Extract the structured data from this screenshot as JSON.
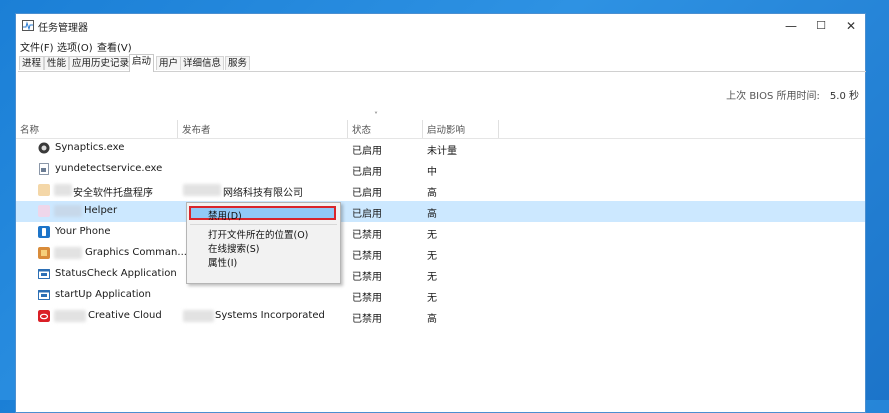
{
  "window": {
    "title": "任务管理器",
    "controls": [
      "—",
      "☐",
      "✕"
    ]
  },
  "menu": [
    "文件(F)",
    "选项(O)",
    "查看(V)"
  ],
  "tabs": [
    "进程",
    "性能",
    "应用历史记录",
    "启动",
    "用户",
    "详细信息",
    "服务"
  ],
  "active_tab": "启动",
  "bios": {
    "label": "上次 BIOS 所用时间:",
    "value": "5.0 秒"
  },
  "columns": {
    "name": "名称",
    "publisher": "发布者",
    "status": "状态",
    "impact": "启动影响"
  },
  "sort_indicator": "˅",
  "rows": [
    {
      "name": "Synaptics.exe",
      "publisher": "",
      "status": "已启用",
      "impact": "未计量",
      "icon_color": "#3a3a3a",
      "icon": "synaptics-icon"
    },
    {
      "name": "yundetectservice.exe",
      "publisher": "",
      "status": "已启用",
      "impact": "中",
      "icon_color": "#6b7c93",
      "icon": "exe-icon"
    },
    {
      "name": "安全软件托盘程序",
      "publisher": "网络科技有限公司",
      "status": "已启用",
      "impact": "高",
      "icon_color": "#f4d7a8",
      "icon": "tray-icon"
    },
    {
      "name": "Helper",
      "publisher": "",
      "status": "已启用",
      "impact": "高",
      "icon_color": "#efd6ea",
      "icon": "helper-icon"
    },
    {
      "name": "Your Phone",
      "publisher": "",
      "status": "已禁用",
      "impact": "无",
      "icon_color": "#1d74c9",
      "icon": "phone-icon"
    },
    {
      "name": "Graphics Comman...",
      "publisher": "",
      "status": "已禁用",
      "impact": "无",
      "icon_color": "#d98c3a",
      "icon": "graphics-icon"
    },
    {
      "name": "StatusCheck Application",
      "publisher": "",
      "status": "已禁用",
      "impact": "无",
      "icon_color": "#2c6fb5",
      "icon": "app-window-icon"
    },
    {
      "name": "startUp Application",
      "publisher": "",
      "status": "已禁用",
      "impact": "无",
      "icon_color": "#2c6fb5",
      "icon": "app-window-icon"
    },
    {
      "name": "Creative Cloud",
      "publisher": "Systems Incorporated",
      "status": "已禁用",
      "impact": "高",
      "icon_color": "#da1f26",
      "icon": "creative-cloud-icon"
    }
  ],
  "context_menu": [
    "禁用(D)",
    "打开文件所在的位置(O)",
    "在线搜索(S)",
    "属性(I)"
  ],
  "colors": {
    "selection": "#cce8ff",
    "highlight_border": "#d9252b",
    "menu_highlight": "#91c9f7"
  }
}
